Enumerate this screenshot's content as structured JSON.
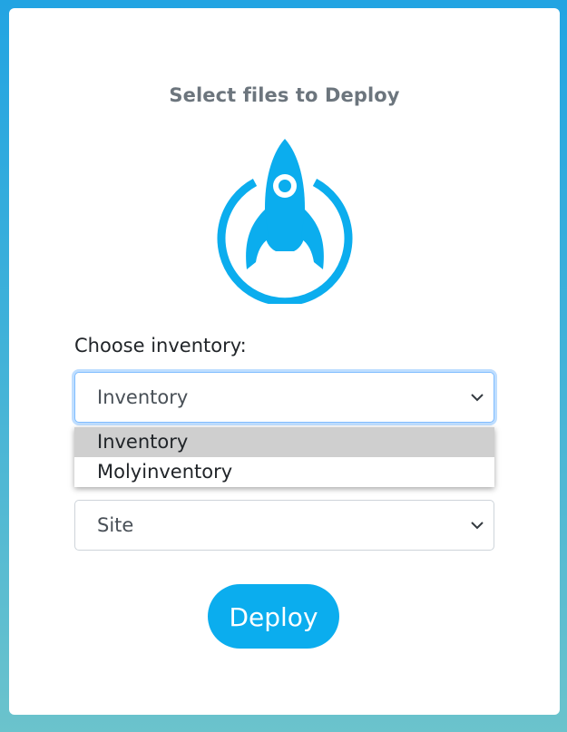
{
  "page": {
    "title": "Select files to Deploy",
    "logo_icon": "rocket-icon",
    "accent_color": "#0badee"
  },
  "form": {
    "inventory_label": "Choose inventory:",
    "inventory_select": {
      "value": "Inventory",
      "options": [
        "Inventory",
        "Molyinventory"
      ],
      "highlighted": "Inventory",
      "expanded": true
    },
    "site_select": {
      "value": "Site"
    },
    "deploy_button": "Deploy"
  }
}
